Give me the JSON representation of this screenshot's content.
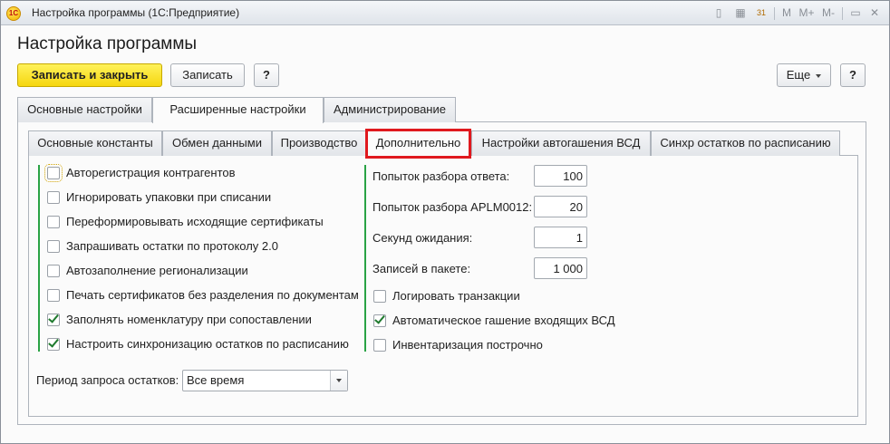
{
  "window": {
    "title": "Настройка программы  (1С:Предприятие)",
    "logo_text": "1С",
    "toolbar_icons": [
      "document-icon",
      "calculator-icon",
      "calendar-icon",
      "memory-m-icon",
      "memory-m-plus-icon",
      "memory-m-minus-icon",
      "restore-icon",
      "close-icon"
    ],
    "toolbar_glyphs": [
      "▯",
      "▦",
      "31",
      "M",
      "M+",
      "M-",
      "▭",
      "✕"
    ]
  },
  "form": {
    "title": "Настройка программы",
    "buttons": {
      "save_close": "Записать и закрыть",
      "save": "Записать",
      "help": "?",
      "more": "Еще",
      "help_right": "?"
    }
  },
  "tabs_top": [
    {
      "label": "Основные настройки",
      "active": false
    },
    {
      "label": "Расширенные настройки",
      "active": true
    },
    {
      "label": "Администрирование",
      "active": false
    }
  ],
  "tabs_inner": [
    {
      "label": "Основные константы",
      "active": false
    },
    {
      "label": "Обмен данными",
      "active": false
    },
    {
      "label": "Производство",
      "active": false
    },
    {
      "label": "Дополнительно",
      "active": true
    },
    {
      "label": "Настройки автогашения ВСД",
      "active": false
    },
    {
      "label": "Синхр остатков по расписанию",
      "active": false
    }
  ],
  "left_options": [
    {
      "label": "Авторегистрация контрагентов",
      "checked": false
    },
    {
      "label": "Игнорировать упаковки при списании",
      "checked": false
    },
    {
      "label": "Переформировывать исходящие сертификаты",
      "checked": false
    },
    {
      "label": "Запрашивать остатки по протоколу 2.0",
      "checked": false
    },
    {
      "label": "Автозаполнение регионализации",
      "checked": false
    },
    {
      "label": "Печать сертификатов без разделения по документам",
      "checked": false
    },
    {
      "label": "Заполнять номенклатуру при сопоставлении",
      "checked": true
    },
    {
      "label": "Настроить синхронизацию остатков по расписанию",
      "checked": true
    }
  ],
  "right_fields": [
    {
      "label": "Попыток разбора ответа:",
      "value": "100"
    },
    {
      "label": "Попыток разбора APLM0012:",
      "value": "20"
    },
    {
      "label": "Секунд ожидания:",
      "value": "1"
    },
    {
      "label": "Записей в пакете:",
      "value": "1 000"
    }
  ],
  "right_options": [
    {
      "label": "Логировать транзакции",
      "checked": false
    },
    {
      "label": "Автоматическое гашение входящих ВСД",
      "checked": true
    },
    {
      "label": "Инвентаризация построчно",
      "checked": false
    }
  ],
  "period": {
    "label": "Период запроса остатков:",
    "value": "Все время"
  },
  "colors": {
    "accent_green": "#2aa345",
    "primary_button": "#f5d60f",
    "highlight_red": "#e0191e"
  }
}
